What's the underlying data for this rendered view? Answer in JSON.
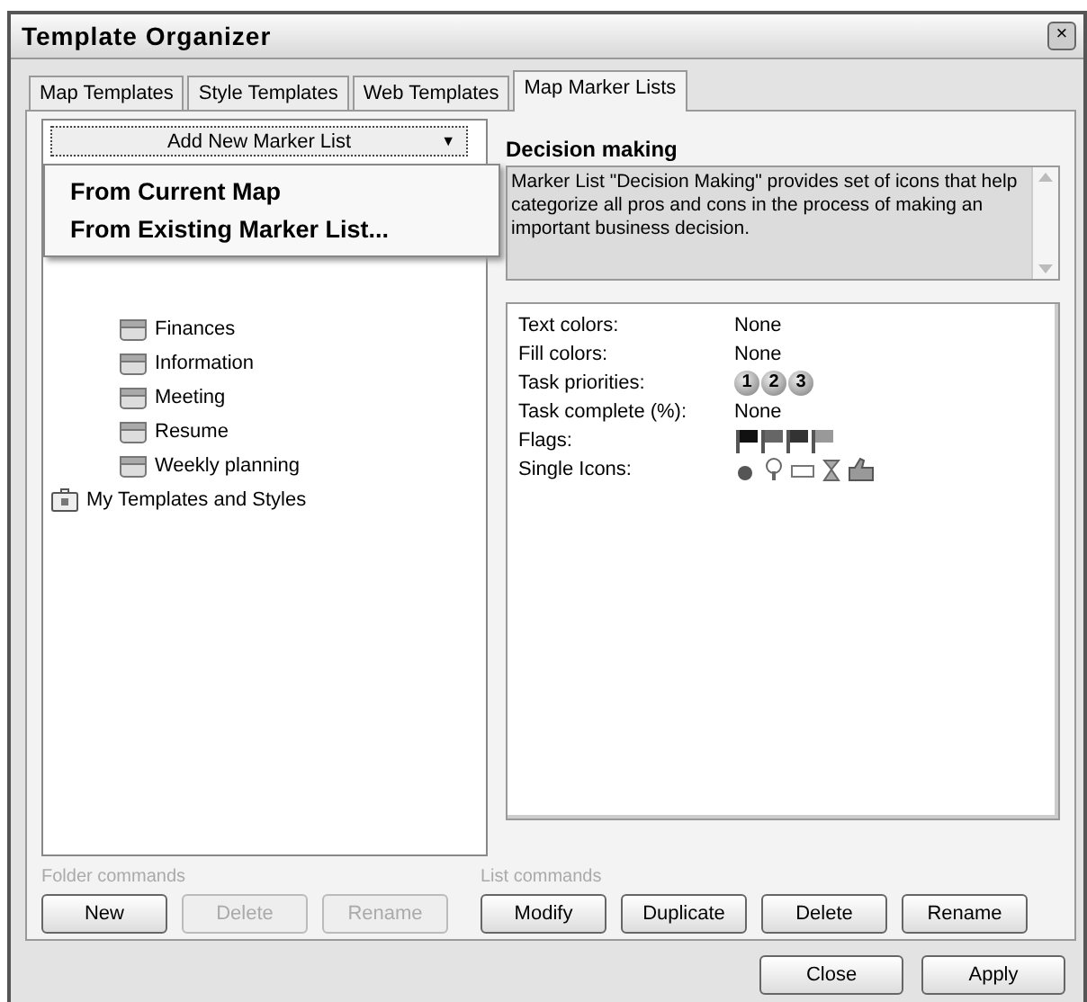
{
  "window": {
    "title": "Template Organizer",
    "close": "×"
  },
  "tabs": [
    {
      "label": "Map Templates",
      "selected": false
    },
    {
      "label": "Style Templates",
      "selected": false
    },
    {
      "label": "Web Templates",
      "selected": false
    },
    {
      "label": "Map Marker Lists",
      "selected": true
    }
  ],
  "add_button": {
    "label": "Add New Marker List",
    "caret": "▼"
  },
  "menu": [
    "From Current Map",
    "From Existing Marker List..."
  ],
  "tree": [
    {
      "label": "Finances",
      "kind": "list"
    },
    {
      "label": "Information",
      "kind": "list"
    },
    {
      "label": "Meeting",
      "kind": "list"
    },
    {
      "label": "Resume",
      "kind": "list"
    },
    {
      "label": "Weekly planning",
      "kind": "list"
    },
    {
      "label": "My Templates and Styles",
      "kind": "folder"
    }
  ],
  "detail": {
    "title": "Decision making",
    "description": "Marker List \"Decision Making\" provides set of icons that help categorize all pros and cons in the process of making an important business decision."
  },
  "markers": [
    {
      "label": "Text colors:",
      "kind": "text",
      "value": "None"
    },
    {
      "label": "Fill colors:",
      "kind": "text",
      "value": "None"
    },
    {
      "label": "Task priorities:",
      "kind": "priorities",
      "values": [
        "1",
        "2",
        "3"
      ]
    },
    {
      "label": "Task complete (%):",
      "kind": "text",
      "value": "None"
    },
    {
      "label": "Flags:",
      "kind": "flags"
    },
    {
      "label": "Single Icons:",
      "kind": "icons"
    }
  ],
  "folder_commands": {
    "label": "Folder commands",
    "buttons": [
      {
        "label": "New",
        "disabled": false
      },
      {
        "label": "Delete",
        "disabled": true
      },
      {
        "label": "Rename",
        "disabled": true
      }
    ]
  },
  "list_commands": {
    "label": "List commands",
    "buttons": [
      {
        "label": "Modify",
        "disabled": false
      },
      {
        "label": "Duplicate",
        "disabled": false
      },
      {
        "label": "Delete",
        "disabled": false
      },
      {
        "label": "Rename",
        "disabled": false
      }
    ]
  },
  "footer_buttons": [
    "Close",
    "Apply"
  ]
}
